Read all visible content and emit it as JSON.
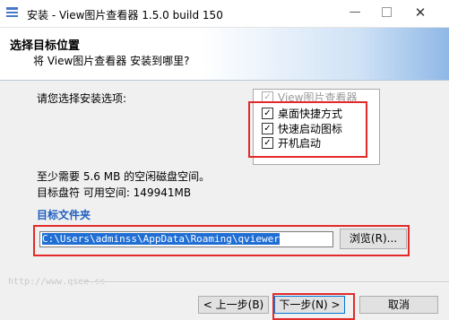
{
  "window": {
    "title": "安装 - View图片查看器 1.5.0 build 150",
    "minimize": "—",
    "close": "✕"
  },
  "header": {
    "title": "选择目标位置",
    "subtitle": "将 View图片查看器 安装到哪里?"
  },
  "body": {
    "prompt": "请您选择安装选项:",
    "options": [
      {
        "label": "View图片查看器",
        "checked": true,
        "enabled": false
      },
      {
        "label": "桌面快捷方式",
        "checked": true,
        "enabled": true
      },
      {
        "label": "快速启动图标",
        "checked": true,
        "enabled": true
      },
      {
        "label": "开机启动",
        "checked": true,
        "enabled": true
      }
    ],
    "check_mark": "✓",
    "space_required": "至少需要 5.6 MB 的空闲磁盘空间。",
    "space_available": "目标盘符 可用空间: 149941MB",
    "folder_label": "目标文件夹",
    "path_value": "C:\\Users\\adminss\\AppData\\Roaming\\qviewer",
    "browse_label": "浏览(R)..."
  },
  "watermark": "http://www.qsee.cc",
  "footer": {
    "back_label": "< 上一步(B)",
    "next_label": "下一步(N) >",
    "cancel_label": "取消"
  },
  "colors": {
    "highlight": "#e32a2a",
    "folder_label": "#1f5fc0",
    "selection": "#1f6ed4"
  }
}
